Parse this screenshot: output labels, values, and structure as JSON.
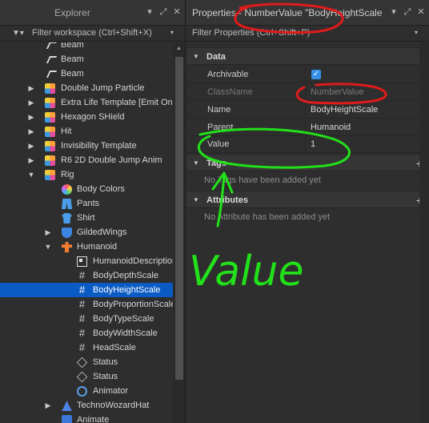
{
  "explorer": {
    "title": "Explorer",
    "filter_placeholder": "Filter workspace (Ctrl+Shift+X)",
    "items": [
      {
        "label": "Beam",
        "icon": "beam-icon"
      },
      {
        "label": "Beam",
        "icon": "beam-icon"
      },
      {
        "label": "Beam",
        "icon": "beam-icon"
      },
      {
        "label": "Double Jump Particle",
        "icon": "model-icon"
      },
      {
        "label": "Extra Life  Template [Emit On",
        "icon": "model-icon"
      },
      {
        "label": "Hexagon SHield",
        "icon": "model-icon"
      },
      {
        "label": "Hit",
        "icon": "model-icon"
      },
      {
        "label": "Invisibility Template",
        "icon": "model-icon"
      },
      {
        "label": "R6 2D Double Jump Anim",
        "icon": "model-icon"
      },
      {
        "label": "Rig",
        "icon": "model-icon"
      },
      {
        "label": "Body Colors",
        "icon": "body-colors-icon"
      },
      {
        "label": "Pants",
        "icon": "pants-icon"
      },
      {
        "label": "Shirt",
        "icon": "shirt-icon"
      },
      {
        "label": "GildedWings",
        "icon": "accessory-icon"
      },
      {
        "label": "Humanoid",
        "icon": "humanoid-icon"
      },
      {
        "label": "HumanoidDescription",
        "icon": "humanoid-description-icon"
      },
      {
        "label": "BodyDepthScale",
        "icon": "number-value-icon"
      },
      {
        "label": "BodyHeightScale",
        "icon": "number-value-icon"
      },
      {
        "label": "BodyProportionScale",
        "icon": "number-value-icon"
      },
      {
        "label": "BodyTypeScale",
        "icon": "number-value-icon"
      },
      {
        "label": "BodyWidthScale",
        "icon": "number-value-icon"
      },
      {
        "label": "HeadScale",
        "icon": "number-value-icon"
      },
      {
        "label": "Status",
        "icon": "status-icon"
      },
      {
        "label": "Status",
        "icon": "status-icon"
      },
      {
        "label": "Animator",
        "icon": "animator-icon"
      },
      {
        "label": "TechnoWozardHat",
        "icon": "hat-icon"
      },
      {
        "label": "Animate",
        "icon": "script-icon"
      }
    ]
  },
  "properties": {
    "title": "Properties - NumberValue \"BodyHeightScale\"",
    "filter_placeholder": "Filter Properties (Ctrl+Shift+P)",
    "sections": {
      "data": "Data",
      "tags": "Tags",
      "attributes": "Attributes"
    },
    "rows": {
      "archivable": {
        "name": "Archivable",
        "checked": true
      },
      "classname": {
        "name": "ClassName",
        "value": "NumberValue"
      },
      "name": {
        "name": "Name",
        "value": "BodyHeightScale"
      },
      "parent": {
        "name": "Parent",
        "value": "Humanoid"
      },
      "value": {
        "name": "Value",
        "value": "1"
      }
    },
    "tags_empty": "No Tags have been added yet",
    "attributes_empty": "No Attribute has been added yet"
  },
  "annotation": {
    "handwritten_text": "Value",
    "colors": {
      "red_circle": "#e01b1b",
      "green_marker": "#22e01a"
    }
  },
  "colors": {
    "selection": "#0b5bc5",
    "panel_bg": "#2e2e2e",
    "checkbox": "#3590ea"
  }
}
